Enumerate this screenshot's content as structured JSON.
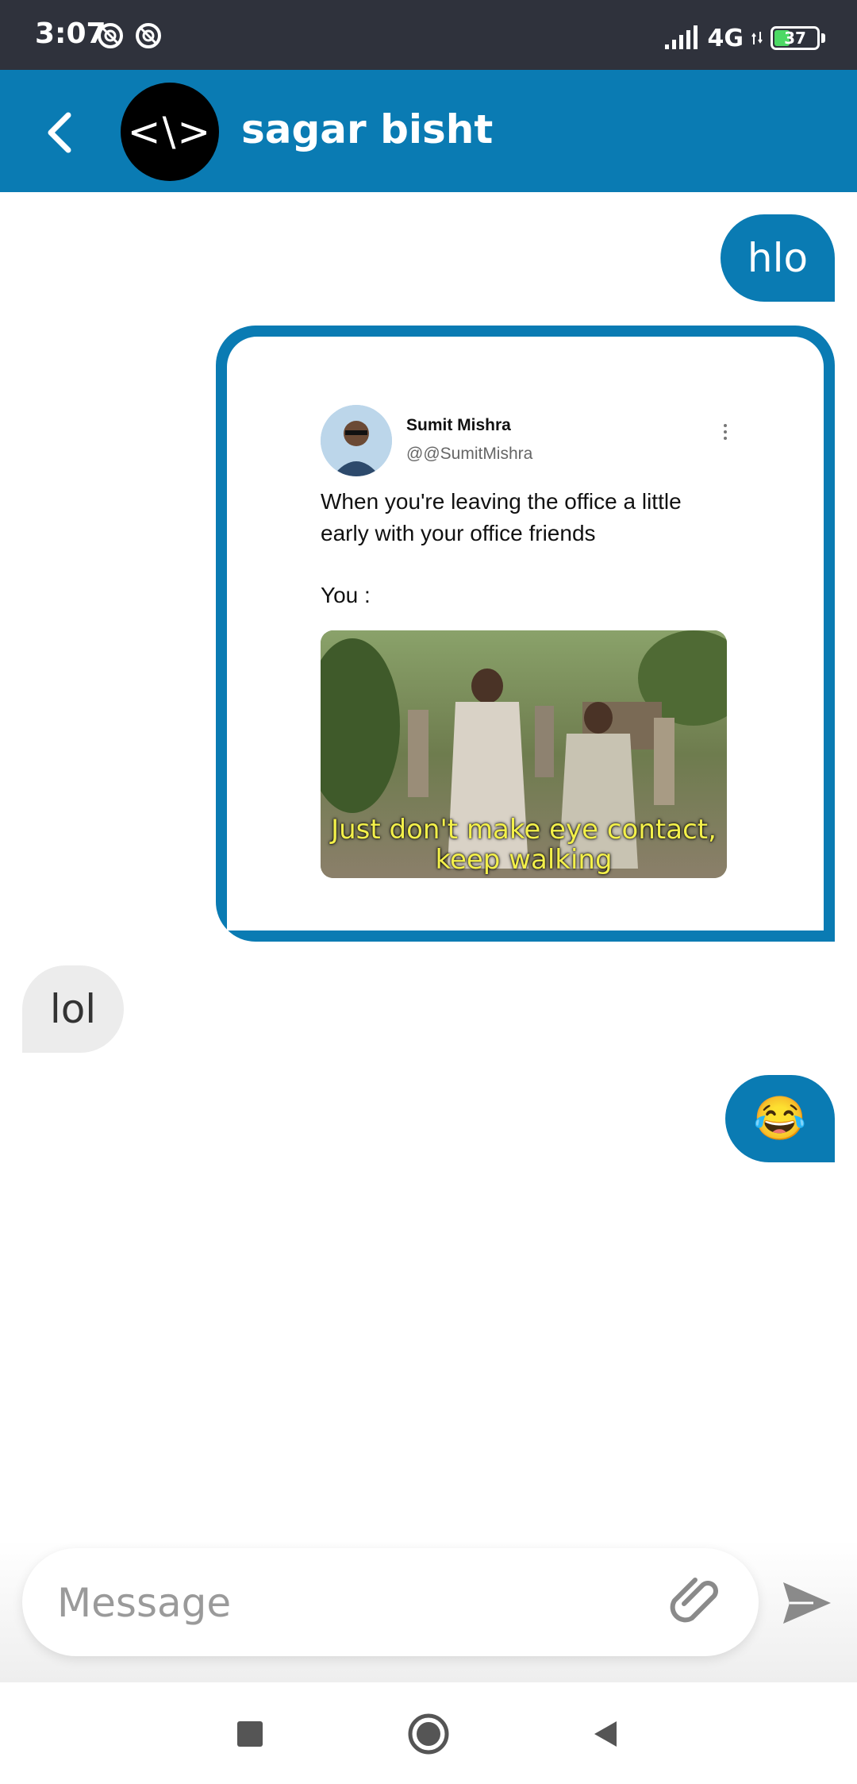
{
  "status_bar": {
    "time": "3:07",
    "network": "4G",
    "battery": "37",
    "battery_level": 0.37
  },
  "header": {
    "avatar_text": "<\\>",
    "contact_name": "sagar bisht"
  },
  "messages": {
    "m1": {
      "text": "hlo",
      "direction": "outgoing"
    },
    "tweet_image": {
      "author": "Sumit Mishra",
      "handle": "@@SumitMishra",
      "text": "When you're leaving the office a little early with your office friends",
      "you_label": "You :",
      "caption_line1": "Just don't make eye contact,",
      "caption_line2": "keep walking"
    },
    "m3": {
      "text": "lol",
      "direction": "incoming"
    },
    "m4": {
      "text": "😂",
      "direction": "outgoing"
    }
  },
  "composer": {
    "placeholder": "Message",
    "attach_icon": "paperclip-icon",
    "send_icon": "send-icon"
  },
  "colors": {
    "primary": "#0a7bb3",
    "status_bar": "#2f323c",
    "incoming_bubble": "#ececec"
  }
}
